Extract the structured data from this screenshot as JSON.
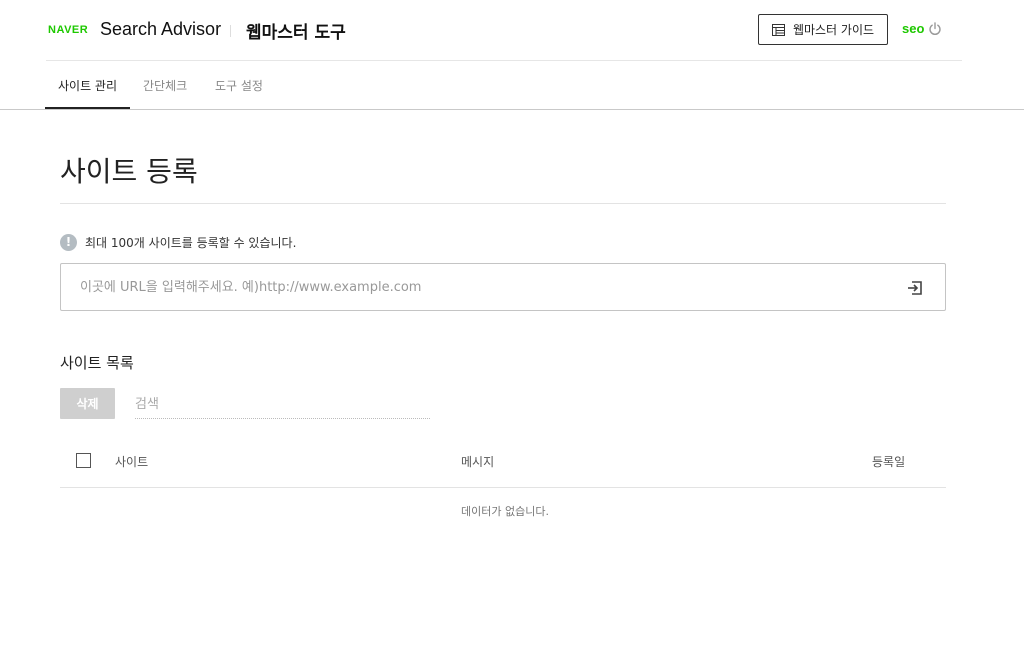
{
  "header": {
    "brand_logo": "NAVER",
    "brand_name": "Search Advisor",
    "tool_title": "웹마스터 도구",
    "guide_button_label": "웹마스터 가이드",
    "guide_icon": "document-list-icon",
    "user_name": "seo",
    "logout_icon": "power-icon"
  },
  "tabs": [
    {
      "label": "사이트 관리",
      "active": true
    },
    {
      "label": "간단체크",
      "active": false
    },
    {
      "label": "도구 설정",
      "active": false
    }
  ],
  "main": {
    "page_title": "사이트 등록",
    "info_icon": "exclamation-circle-icon",
    "info_text": "최대 100개 사이트를 등록할 수 있습니다.",
    "url_input": {
      "value": "",
      "placeholder": "이곳에 URL을 입력해주세요. 예)http://www.example.com"
    },
    "submit_icon": "enter-icon"
  },
  "site_list": {
    "section_title": "사이트 목록",
    "delete_button_label": "삭제",
    "search": {
      "value": "",
      "placeholder": "검색"
    },
    "columns": [
      "사이트",
      "메시지",
      "등록일"
    ],
    "rows": [],
    "empty_text": "데이터가 없습니다."
  },
  "colors": {
    "brand_green": "#1ec800",
    "text_primary": "#222222",
    "disabled_button": "#cfcfcf",
    "info_icon_bg": "#b4bcc2"
  }
}
